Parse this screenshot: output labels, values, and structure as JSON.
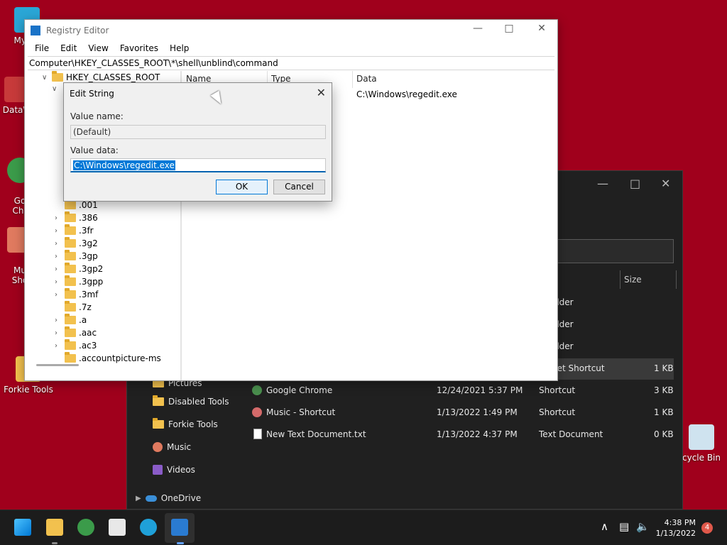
{
  "desktop": {
    "icons": [
      {
        "label": "My Co"
      },
      {
        "label": "DataW"
      },
      {
        "label": "Go\nChr"
      },
      {
        "label": "Mu\nSho"
      },
      {
        "label": "Forkie Tools"
      },
      {
        "label": "cycle Bin"
      }
    ]
  },
  "regedit": {
    "title": "Registry Editor",
    "menu": [
      "File",
      "Edit",
      "View",
      "Favorites",
      "Help"
    ],
    "address": "Computer\\HKEY_CLASSES_ROOT\\*\\shell\\unblind\\command",
    "tree": [
      "HKEY_CLASSES_ROOT",
      ".001",
      ".386",
      ".3fr",
      ".3g2",
      ".3gp",
      ".3gp2",
      ".3gpp",
      ".3mf",
      ".7z",
      ".a",
      ".aac",
      ".ac3",
      ".accountpicture-ms"
    ],
    "columns": {
      "name": "Name",
      "type": "Type",
      "data": "Data"
    },
    "row_data": "C:\\Windows\\regedit.exe"
  },
  "dialog": {
    "title": "Edit String",
    "value_name_label": "Value name:",
    "value_name": "(Default)",
    "value_data_label": "Value data:",
    "value_data": "C:\\Windows\\regedit.exe",
    "ok": "OK",
    "cancel": "Cancel"
  },
  "explorer": {
    "columns": {
      "size": "Size"
    },
    "rows": [
      {
        "name": "older",
        "date": "",
        "type": "",
        "size": ""
      },
      {
        "name": "older",
        "date": "",
        "type": "",
        "size": ""
      },
      {
        "name": "older",
        "date": "",
        "type": "",
        "size": ""
      },
      {
        "name": "net Shortcut",
        "date": "",
        "type": "",
        "size": "1 KB"
      },
      {
        "name": "Google Chrome",
        "date": "12/24/2021 5:37 PM",
        "type": "Shortcut",
        "size": "3 KB"
      },
      {
        "name": "Music - Shortcut",
        "date": "1/13/2022 1:49 PM",
        "type": "Shortcut",
        "size": "1 KB"
      },
      {
        "name": "New Text Document.txt",
        "date": "1/13/2022 4:37 PM",
        "type": "Text Document",
        "size": "0 KB"
      }
    ],
    "nav": [
      "Pictures",
      "Disabled Tools",
      "Forkie Tools",
      "Music",
      "Videos",
      "OneDrive"
    ]
  },
  "taskbar": {
    "time": "4:38 PM",
    "date": "1/13/2022",
    "notifications": "4"
  }
}
